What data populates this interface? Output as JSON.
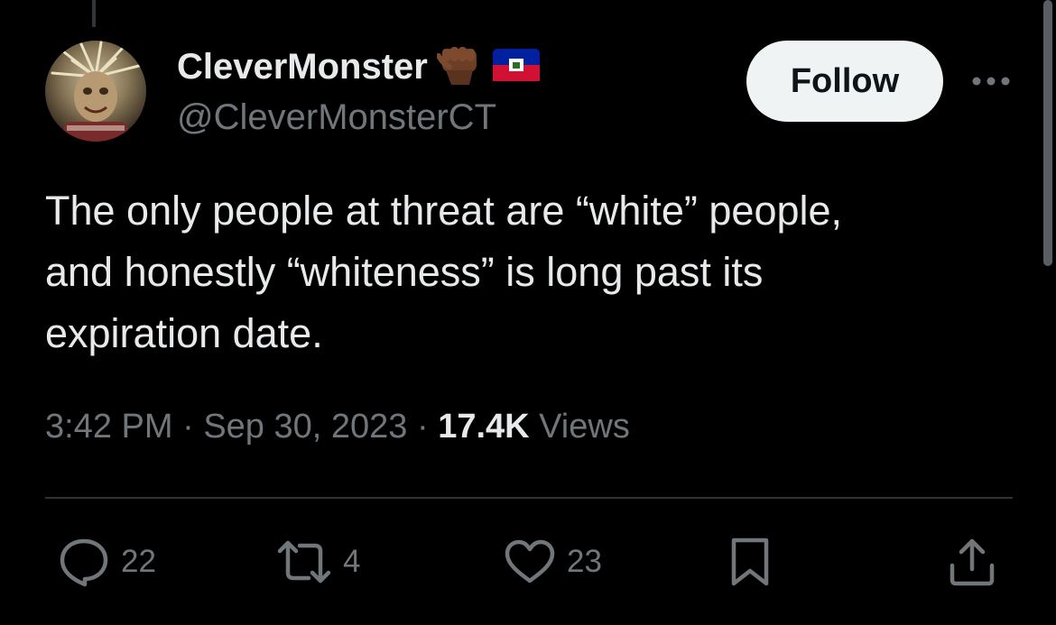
{
  "author": {
    "display_name": "CleverMonster",
    "handle": "@CleverMonsterCT",
    "badges": [
      "raised-fist-emoji",
      "haiti-flag-emoji"
    ]
  },
  "follow_label": "Follow",
  "tweet": {
    "text": "The only people at threat are “white” people,\nand honestly “whiteness” is long past its\nexpiration date.",
    "time": "3:42 PM",
    "separator": " · ",
    "date": "Sep 30, 2023",
    "views_count": "17.4K",
    "views_label": " Views"
  },
  "actions": {
    "replies": "22",
    "reposts": "4",
    "likes": "23"
  },
  "colors": {
    "background": "#000000",
    "text_primary": "#e7e9ea",
    "text_secondary": "#71767b",
    "follow_bg": "#eff3f4"
  }
}
